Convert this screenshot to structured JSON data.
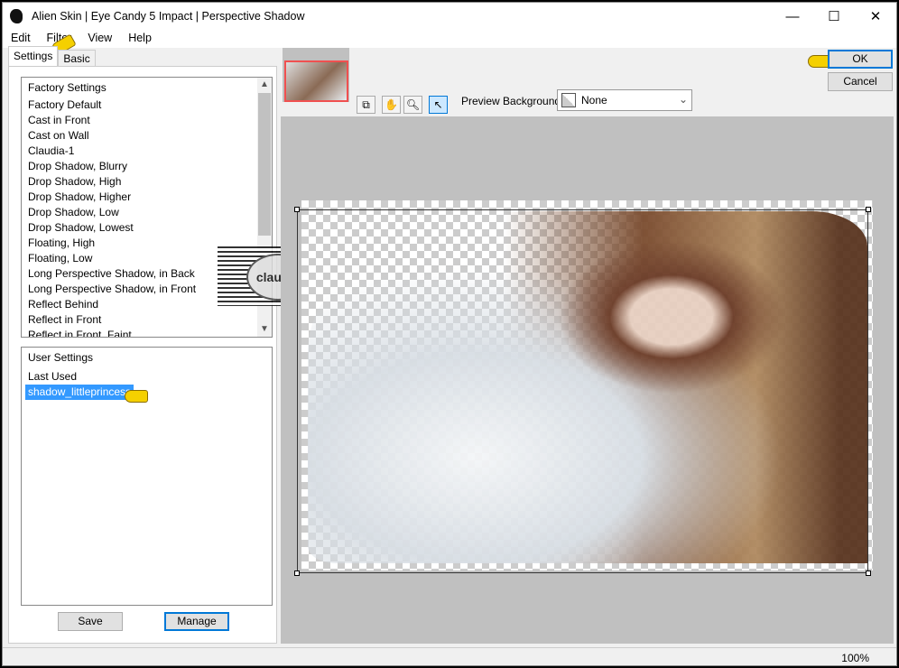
{
  "window": {
    "title": "Alien Skin | Eye Candy 5 Impact | Perspective Shadow",
    "minimize": "—",
    "maximize": "☐",
    "close": "✕"
  },
  "menu": [
    "Edit",
    "Filter",
    "View",
    "Help"
  ],
  "tabs": [
    "Settings",
    "Basic"
  ],
  "factory": {
    "header": "Factory Settings",
    "items": [
      "Factory Default",
      "Cast in Front",
      "Cast on Wall",
      "Claudia-1",
      "Drop Shadow, Blurry",
      "Drop Shadow, High",
      "Drop Shadow, Higher",
      "Drop Shadow, Low",
      "Drop Shadow, Lowest",
      "Floating, High",
      "Floating, Low",
      "Long Perspective Shadow, in Back",
      "Long Perspective Shadow, in Front",
      "Reflect Behind",
      "Reflect in Front",
      "Reflect in Front, Faint"
    ]
  },
  "user": {
    "header": "User Settings",
    "items": [
      "Last Used"
    ],
    "selected": "shadow_littleprincess"
  },
  "buttons": {
    "save": "Save",
    "manage": "Manage",
    "ok": "OK",
    "cancel": "Cancel"
  },
  "preview": {
    "background_label": "Preview Background:",
    "background_value": "None"
  },
  "watermark": "claudia",
  "status": {
    "zoom": "100%"
  }
}
